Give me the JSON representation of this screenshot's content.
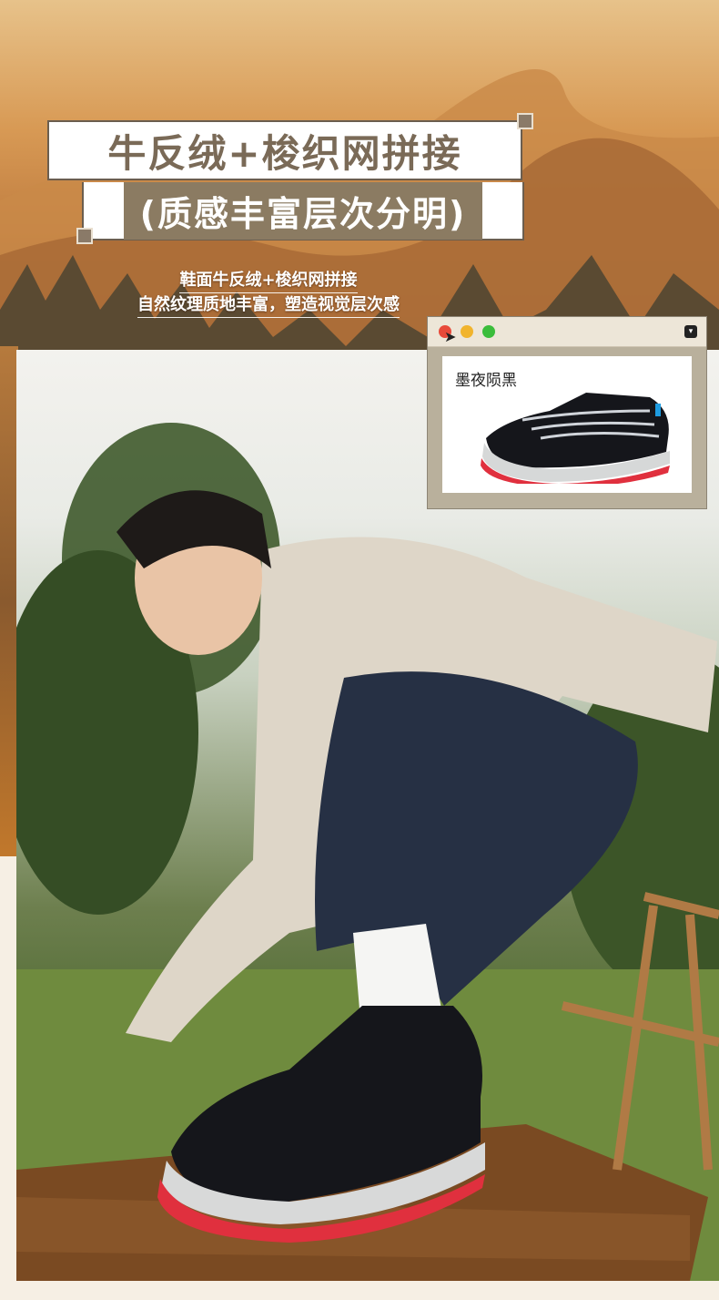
{
  "title": {
    "line1": "牛反绒+梭织网拼接",
    "line2": "(质感丰富层次分明)"
  },
  "subtitle": {
    "line1": "鞋面牛反绒+梭织网拼接",
    "line2": "自然纹理质地丰富，塑造视觉层次感"
  },
  "window": {
    "color_name": "墨夜陨黑",
    "menu_glyph": "▾",
    "buttons": [
      "close",
      "minimize",
      "maximize"
    ]
  },
  "colors": {
    "title_text": "#7a6a57",
    "title_band": "#8b7b62",
    "window_frame": "#b9b09c",
    "close": "#e84a3a",
    "minimize": "#f1b42d",
    "maximize": "#3bbd3b",
    "sole_red": "#e0303e"
  }
}
